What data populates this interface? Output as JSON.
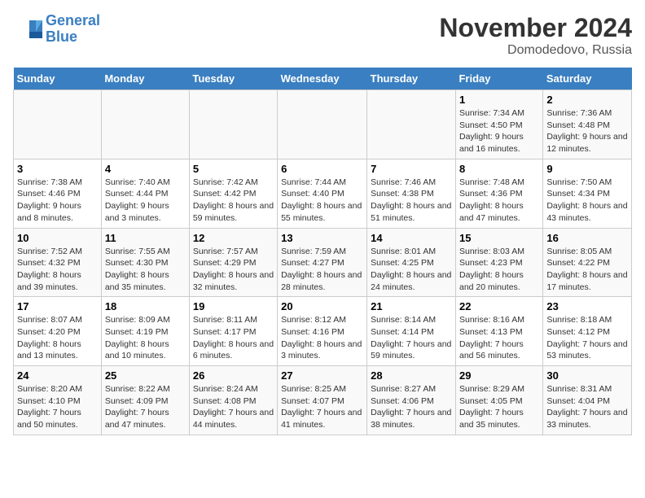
{
  "logo": {
    "line1": "General",
    "line2": "Blue"
  },
  "title": "November 2024",
  "location": "Domodedovo, Russia",
  "days_of_week": [
    "Sunday",
    "Monday",
    "Tuesday",
    "Wednesday",
    "Thursday",
    "Friday",
    "Saturday"
  ],
  "weeks": [
    [
      {
        "day": "",
        "info": ""
      },
      {
        "day": "",
        "info": ""
      },
      {
        "day": "",
        "info": ""
      },
      {
        "day": "",
        "info": ""
      },
      {
        "day": "",
        "info": ""
      },
      {
        "day": "1",
        "info": "Sunrise: 7:34 AM\nSunset: 4:50 PM\nDaylight: 9 hours and 16 minutes."
      },
      {
        "day": "2",
        "info": "Sunrise: 7:36 AM\nSunset: 4:48 PM\nDaylight: 9 hours and 12 minutes."
      }
    ],
    [
      {
        "day": "3",
        "info": "Sunrise: 7:38 AM\nSunset: 4:46 PM\nDaylight: 9 hours and 8 minutes."
      },
      {
        "day": "4",
        "info": "Sunrise: 7:40 AM\nSunset: 4:44 PM\nDaylight: 9 hours and 3 minutes."
      },
      {
        "day": "5",
        "info": "Sunrise: 7:42 AM\nSunset: 4:42 PM\nDaylight: 8 hours and 59 minutes."
      },
      {
        "day": "6",
        "info": "Sunrise: 7:44 AM\nSunset: 4:40 PM\nDaylight: 8 hours and 55 minutes."
      },
      {
        "day": "7",
        "info": "Sunrise: 7:46 AM\nSunset: 4:38 PM\nDaylight: 8 hours and 51 minutes."
      },
      {
        "day": "8",
        "info": "Sunrise: 7:48 AM\nSunset: 4:36 PM\nDaylight: 8 hours and 47 minutes."
      },
      {
        "day": "9",
        "info": "Sunrise: 7:50 AM\nSunset: 4:34 PM\nDaylight: 8 hours and 43 minutes."
      }
    ],
    [
      {
        "day": "10",
        "info": "Sunrise: 7:52 AM\nSunset: 4:32 PM\nDaylight: 8 hours and 39 minutes."
      },
      {
        "day": "11",
        "info": "Sunrise: 7:55 AM\nSunset: 4:30 PM\nDaylight: 8 hours and 35 minutes."
      },
      {
        "day": "12",
        "info": "Sunrise: 7:57 AM\nSunset: 4:29 PM\nDaylight: 8 hours and 32 minutes."
      },
      {
        "day": "13",
        "info": "Sunrise: 7:59 AM\nSunset: 4:27 PM\nDaylight: 8 hours and 28 minutes."
      },
      {
        "day": "14",
        "info": "Sunrise: 8:01 AM\nSunset: 4:25 PM\nDaylight: 8 hours and 24 minutes."
      },
      {
        "day": "15",
        "info": "Sunrise: 8:03 AM\nSunset: 4:23 PM\nDaylight: 8 hours and 20 minutes."
      },
      {
        "day": "16",
        "info": "Sunrise: 8:05 AM\nSunset: 4:22 PM\nDaylight: 8 hours and 17 minutes."
      }
    ],
    [
      {
        "day": "17",
        "info": "Sunrise: 8:07 AM\nSunset: 4:20 PM\nDaylight: 8 hours and 13 minutes."
      },
      {
        "day": "18",
        "info": "Sunrise: 8:09 AM\nSunset: 4:19 PM\nDaylight: 8 hours and 10 minutes."
      },
      {
        "day": "19",
        "info": "Sunrise: 8:11 AM\nSunset: 4:17 PM\nDaylight: 8 hours and 6 minutes."
      },
      {
        "day": "20",
        "info": "Sunrise: 8:12 AM\nSunset: 4:16 PM\nDaylight: 8 hours and 3 minutes."
      },
      {
        "day": "21",
        "info": "Sunrise: 8:14 AM\nSunset: 4:14 PM\nDaylight: 7 hours and 59 minutes."
      },
      {
        "day": "22",
        "info": "Sunrise: 8:16 AM\nSunset: 4:13 PM\nDaylight: 7 hours and 56 minutes."
      },
      {
        "day": "23",
        "info": "Sunrise: 8:18 AM\nSunset: 4:12 PM\nDaylight: 7 hours and 53 minutes."
      }
    ],
    [
      {
        "day": "24",
        "info": "Sunrise: 8:20 AM\nSunset: 4:10 PM\nDaylight: 7 hours and 50 minutes."
      },
      {
        "day": "25",
        "info": "Sunrise: 8:22 AM\nSunset: 4:09 PM\nDaylight: 7 hours and 47 minutes."
      },
      {
        "day": "26",
        "info": "Sunrise: 8:24 AM\nSunset: 4:08 PM\nDaylight: 7 hours and 44 minutes."
      },
      {
        "day": "27",
        "info": "Sunrise: 8:25 AM\nSunset: 4:07 PM\nDaylight: 7 hours and 41 minutes."
      },
      {
        "day": "28",
        "info": "Sunrise: 8:27 AM\nSunset: 4:06 PM\nDaylight: 7 hours and 38 minutes."
      },
      {
        "day": "29",
        "info": "Sunrise: 8:29 AM\nSunset: 4:05 PM\nDaylight: 7 hours and 35 minutes."
      },
      {
        "day": "30",
        "info": "Sunrise: 8:31 AM\nSunset: 4:04 PM\nDaylight: 7 hours and 33 minutes."
      }
    ]
  ]
}
